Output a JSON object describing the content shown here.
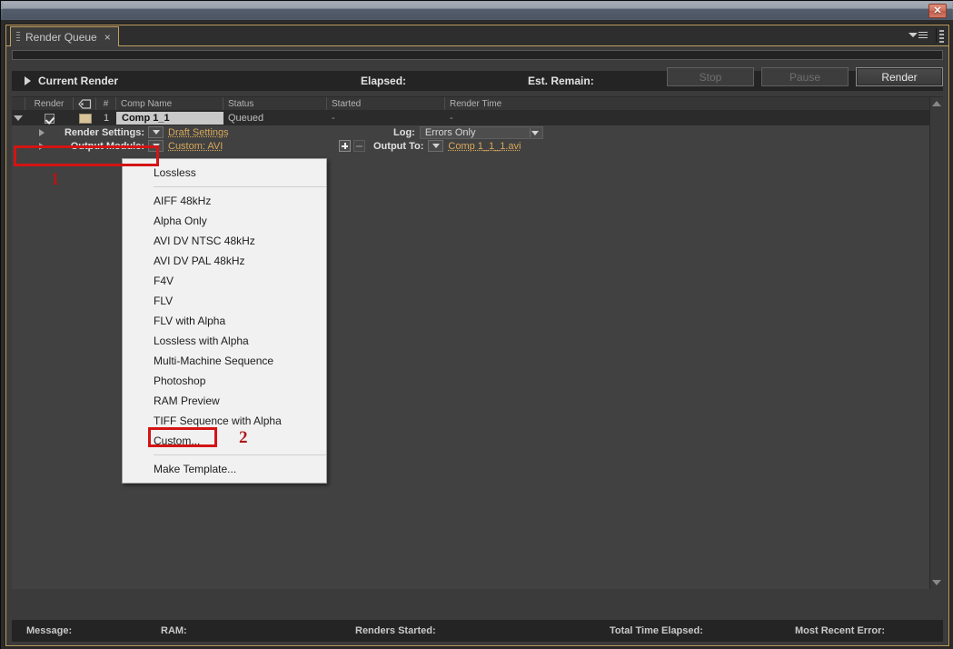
{
  "window": {
    "close_label": "✕"
  },
  "tab_bar": {
    "tabs": [
      {
        "label": "Render Queue",
        "close": "×"
      }
    ],
    "panel_menu_icon": "panel-menu-icon",
    "panel_grip_icon": "grip-dots-icon"
  },
  "current_render": {
    "title": "Current Render",
    "elapsed_label": "Elapsed:",
    "est_remain_label": "Est. Remain:",
    "buttons": [
      {
        "label": "Stop",
        "enabled": false
      },
      {
        "label": "Pause",
        "enabled": false
      },
      {
        "label": "Render",
        "enabled": true
      }
    ]
  },
  "queue_table": {
    "headers": {
      "render": "Render",
      "label": "label-tag-icon",
      "number": "#",
      "comp_name": "Comp Name",
      "status": "Status",
      "started": "Started",
      "render_time": "Render Time"
    },
    "rows": [
      {
        "checked": true,
        "label_color": "#d8c49a",
        "number": "1",
        "comp_name": "Comp 1_1",
        "status": "Queued",
        "started": "-",
        "render_time": "-"
      }
    ],
    "render_settings": {
      "label": "Render Settings:",
      "value": "Draft Settings",
      "log_label": "Log:",
      "log_value": "Errors Only"
    },
    "output_module": {
      "label": "Output Module:",
      "value": "Custom: AVI",
      "output_to_label": "Output To:",
      "output_to_value": "Comp 1_1_1.avi",
      "add_button": "+",
      "remove_button": "−"
    }
  },
  "template_menu": {
    "groups": [
      {
        "items": [
          "Lossless"
        ]
      },
      {
        "items": [
          "AIFF 48kHz",
          "Alpha Only",
          "AVI DV NTSC 48kHz",
          "AVI DV PAL 48kHz",
          "F4V",
          "FLV",
          "FLV with Alpha",
          "Lossless with Alpha",
          "Multi-Machine Sequence",
          "Photoshop",
          "RAM Preview",
          "TIFF Sequence with Alpha",
          "Custom..."
        ]
      },
      {
        "items": [
          "Make Template..."
        ]
      }
    ]
  },
  "annotations": {
    "marker_1": "1",
    "marker_2": "2",
    "highlight_color": "#d41414"
  },
  "status_bar": {
    "message": "Message:",
    "ram": "RAM:",
    "renders_started": "Renders Started:",
    "total_time_elapsed": "Total Time Elapsed:",
    "most_recent_error": "Most Recent Error:"
  }
}
